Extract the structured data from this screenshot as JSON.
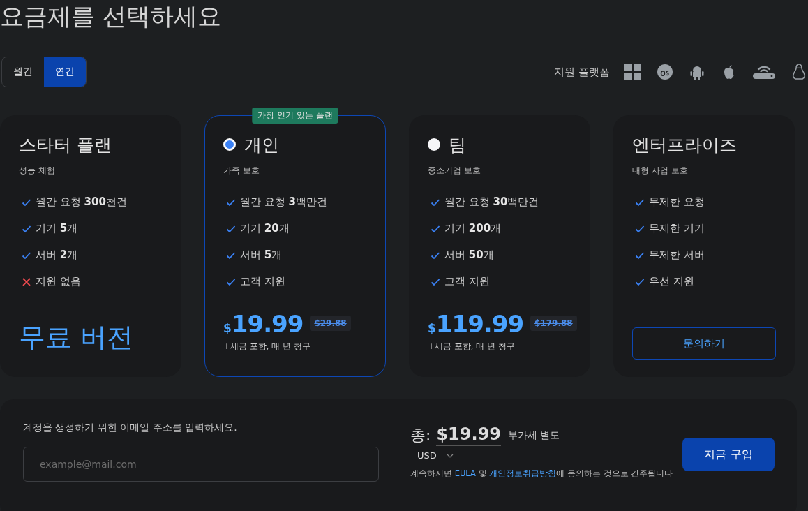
{
  "title": "요금제를 선택하세요",
  "billing_tabs": [
    {
      "label": "월간",
      "selected": false
    },
    {
      "label": "연간",
      "selected": true
    }
  ],
  "platforms": {
    "label": "지원 플랫폼"
  },
  "plans": [
    {
      "name": "스타터 플랜",
      "subtitle": "성능 체험",
      "highlighted": false,
      "features": [
        {
          "text": "월간 요청 **300**천건",
          "included": true
        },
        {
          "text": "기기 **5**개",
          "included": true
        },
        {
          "text": "서버 **2**개",
          "included": true
        },
        {
          "text": "지원 없음",
          "included": false
        }
      ],
      "footer": {
        "kind": "free",
        "text": "무료 버전"
      }
    },
    {
      "name": "개인",
      "subtitle": "가족 보호",
      "badge": "가장 인기 있는 플랜",
      "highlighted": true,
      "radio": {
        "selected": true
      },
      "features": [
        {
          "text": "월간 요청 **3**백만건",
          "included": true
        },
        {
          "text": "기기 **20**개",
          "included": true
        },
        {
          "text": "서버 **5**개",
          "included": true
        },
        {
          "text": "고객 지원",
          "included": true
        }
      ],
      "footer": {
        "kind": "price",
        "currency": "$",
        "amount": "19.99",
        "old_price": "$29.88",
        "note": "+세금 포함, 매 년 청구"
      }
    },
    {
      "name": "팀",
      "subtitle": "중소기업 보호",
      "highlighted": false,
      "radio": {
        "selected": false
      },
      "features": [
        {
          "text": "월간 요청 **30**백만건",
          "included": true
        },
        {
          "text": "기기 **200**개",
          "included": true
        },
        {
          "text": "서버 **50**개",
          "included": true
        },
        {
          "text": "고객 지원",
          "included": true
        }
      ],
      "footer": {
        "kind": "price",
        "currency": "$",
        "amount": "119.99",
        "old_price": "$179.88",
        "note": "+세금 포함, 매 년 청구"
      }
    },
    {
      "name": "엔터프라이즈",
      "subtitle": "대형 사업 보호",
      "highlighted": false,
      "features": [
        {
          "text": "무제한 요청",
          "included": true
        },
        {
          "text": "무제한 기기",
          "included": true
        },
        {
          "text": "무제한 서버",
          "included": true
        },
        {
          "text": "우선 지원",
          "included": true
        }
      ],
      "footer": {
        "kind": "button",
        "text": "문의하기"
      }
    }
  ],
  "checkout": {
    "email_label": "계정을 생성하기 위한 이메일 주소를 입력하세요.",
    "email_placeholder": "example@mail.com",
    "total_label": "총:",
    "total": "$19.99",
    "vat_note": "부가세 별도",
    "currency": "USD",
    "consent": [
      {
        "kind": "text",
        "text": "계속하시면 "
      },
      {
        "kind": "link",
        "text": "EULA"
      },
      {
        "kind": "text",
        "text": " 및 "
      },
      {
        "kind": "link",
        "text": "개인정보취급방침"
      },
      {
        "kind": "text",
        "text": "에 동의하는 것으로 간주됩니다"
      }
    ],
    "buy_button": "지금 구입"
  }
}
